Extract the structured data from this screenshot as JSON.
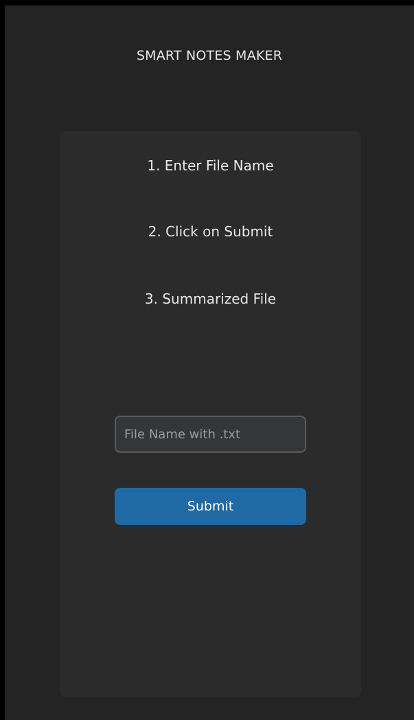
{
  "app": {
    "title": "SMART NOTES MAKER"
  },
  "steps": [
    {
      "label": "1. Enter File Name"
    },
    {
      "label": "2. Click on Submit"
    },
    {
      "label": "3. Summarized File"
    }
  ],
  "form": {
    "file_input": {
      "value": "",
      "placeholder": "File Name with .txt"
    },
    "submit_label": "Submit"
  },
  "colors": {
    "background": "#242424",
    "card": "#2b2b2b",
    "accent": "#1f6aa5",
    "text": "#e8e8e8"
  }
}
